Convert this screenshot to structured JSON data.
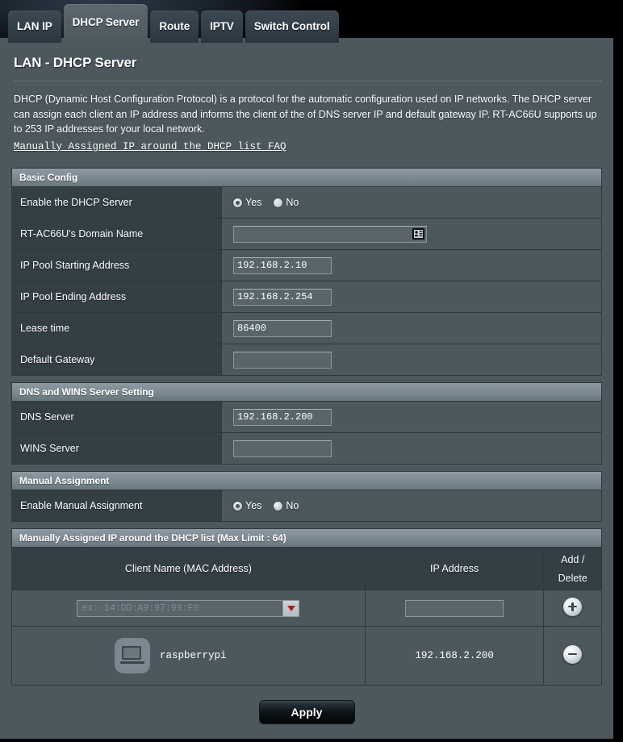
{
  "tabs": [
    {
      "label": "LAN IP",
      "active": false
    },
    {
      "label": "DHCP Server",
      "active": true
    },
    {
      "label": "Route",
      "active": false
    },
    {
      "label": "IPTV",
      "active": false
    },
    {
      "label": "Switch Control",
      "active": false
    }
  ],
  "page": {
    "title": "LAN - DHCP Server",
    "description": "DHCP (Dynamic Host Configuration Protocol) is a protocol for the automatic configuration used on IP networks. The DHCP server can assign each client an IP address and informs the client of the of DNS server IP and default gateway IP. RT-AC66U supports up to 253 IP addresses for your local network.",
    "faq_link": "Manually Assigned IP around the DHCP list FAQ"
  },
  "basic_config": {
    "heading": "Basic Config",
    "enable_dhcp": {
      "label": "Enable the DHCP Server",
      "yes_label": "Yes",
      "no_label": "No",
      "selected": "Yes"
    },
    "domain_name": {
      "label": "RT-AC66U's Domain Name",
      "value": "",
      "icon": "contact-card-icon"
    },
    "pool_start": {
      "label": "IP Pool Starting Address",
      "value": "192.168.2.10"
    },
    "pool_end": {
      "label": "IP Pool Ending Address",
      "value": "192.168.2.254"
    },
    "lease_time": {
      "label": "Lease time",
      "value": "86400"
    },
    "default_gateway": {
      "label": "Default Gateway",
      "value": ""
    }
  },
  "dns_wins": {
    "heading": "DNS and WINS Server Setting",
    "dns_server": {
      "label": "DNS Server",
      "value": "192.168.2.200"
    },
    "wins_server": {
      "label": "WINS Server",
      "value": ""
    }
  },
  "manual_assignment": {
    "heading": "Manual Assignment",
    "enable": {
      "label": "Enable Manual Assignment",
      "yes_label": "Yes",
      "no_label": "No",
      "selected": "Yes"
    }
  },
  "assign_list": {
    "heading": "Manually Assigned IP around the DHCP list (Max Limit : 64)",
    "columns": {
      "client": "Client Name (MAC Address)",
      "ip": "IP Address",
      "action_line1": "Add /",
      "action_line2": "Delete"
    },
    "new_row": {
      "mac_placeholder": "ex: 14:DD:A9:97:99:F0",
      "mac_value": "",
      "ip_value": "",
      "add_icon": "plus-circle-icon"
    },
    "rows": [
      {
        "device_icon": "laptop-icon",
        "client_name": "raspberrypi",
        "mac_address": "",
        "mac_redacted": true,
        "ip": "192.168.2.200",
        "delete_icon": "minus-circle-icon"
      }
    ]
  },
  "footer": {
    "apply_label": "Apply"
  },
  "colors": {
    "panel_bg": "#4c575e",
    "row_label_bg": "#333e45",
    "section_head": "#7c8a92",
    "border": "#2e383e",
    "caret_red": "#c01515",
    "text": "#ffffff"
  }
}
